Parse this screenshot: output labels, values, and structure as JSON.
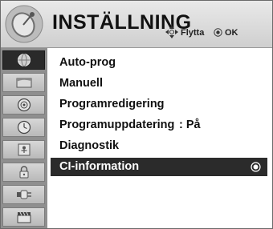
{
  "header": {
    "title": "INSTÄLLNING",
    "move_label": "Flytta",
    "ok_label": "OK",
    "icon": "satellite-dish-icon"
  },
  "sidebar": {
    "items": [
      {
        "icon": "globe-icon",
        "active": true
      },
      {
        "icon": "picture-icon",
        "active": false
      },
      {
        "icon": "speaker-icon",
        "active": false
      },
      {
        "icon": "clock-icon",
        "active": false
      },
      {
        "icon": "parental-lock-icon",
        "active": false
      },
      {
        "icon": "padlock-icon",
        "active": false
      },
      {
        "icon": "input-plug-icon",
        "active": false
      },
      {
        "icon": "clapperboard-icon",
        "active": false
      }
    ]
  },
  "menu": {
    "items": [
      {
        "label": "Auto-prog"
      },
      {
        "label": "Manuell"
      },
      {
        "label": "Programredigering"
      },
      {
        "label": "Programuppdatering",
        "value": ": På"
      },
      {
        "label": "Diagnostik"
      },
      {
        "label": "CI-information",
        "selected": true
      }
    ]
  }
}
